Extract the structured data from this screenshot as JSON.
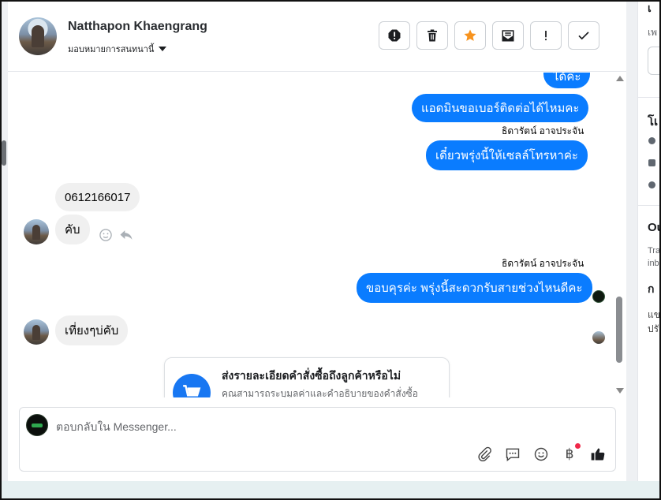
{
  "header": {
    "name": "Natthapon Khaengrang",
    "assign_label": "มอบหมายการสนทนานี้",
    "toolbar": [
      {
        "name": "report-icon",
        "label": "report"
      },
      {
        "name": "trash-icon",
        "label": "delete"
      },
      {
        "name": "star-icon",
        "label": "star",
        "color": "#f7931e"
      },
      {
        "name": "mark-unread-icon",
        "label": "unread"
      },
      {
        "name": "exclamation-icon",
        "label": "follow up"
      },
      {
        "name": "check-icon",
        "label": "done"
      }
    ]
  },
  "messages": {
    "m1": "ได้ค่ะ",
    "m2": "แอดมินขอเบอร์ติดต่อได้ไหมคะ",
    "sender1": "ธิดารัตน์ อาจประจัน",
    "m3": "เดี๋ยวพรุ่งนี้ให้เซลล์โทรหาค่ะ",
    "m4": "0612166017",
    "m5": "คับ",
    "sender2": "ธิดารัตน์ อาจประจัน",
    "m6": "ขอบคุรค่ะ พรุ่งนี้สะดวกรับสายช่วงไหนดีคะ",
    "m7": "เที่ยงๆบ่คับ"
  },
  "order_card": {
    "title": "ส่งรายละเอียดคำสั่งซื้อถึงลูกค้าหรือไม่",
    "description": "คุณสามารถระบุมูลค่าและคำอธิบายของคำสั่งซื้อ"
  },
  "composer": {
    "placeholder": "ตอบกลับใน Messenger...",
    "tools": [
      "attach-icon",
      "saved-reply-icon",
      "emoji-icon",
      "baht-icon",
      "like-icon"
    ]
  },
  "right_panel": {
    "t1": "เ",
    "t2": "เพ",
    "t3": "โเ",
    "t4": "Ou",
    "t5": "Tra",
    "t6": "inb",
    "t7": "ก",
    "t8": "แข",
    "t9": "ปรั"
  },
  "colors": {
    "outgoing_bubble": "#0a7cff",
    "incoming_bubble": "#f0f0f0",
    "accent": "#1877f2",
    "notification": "#f02849"
  }
}
